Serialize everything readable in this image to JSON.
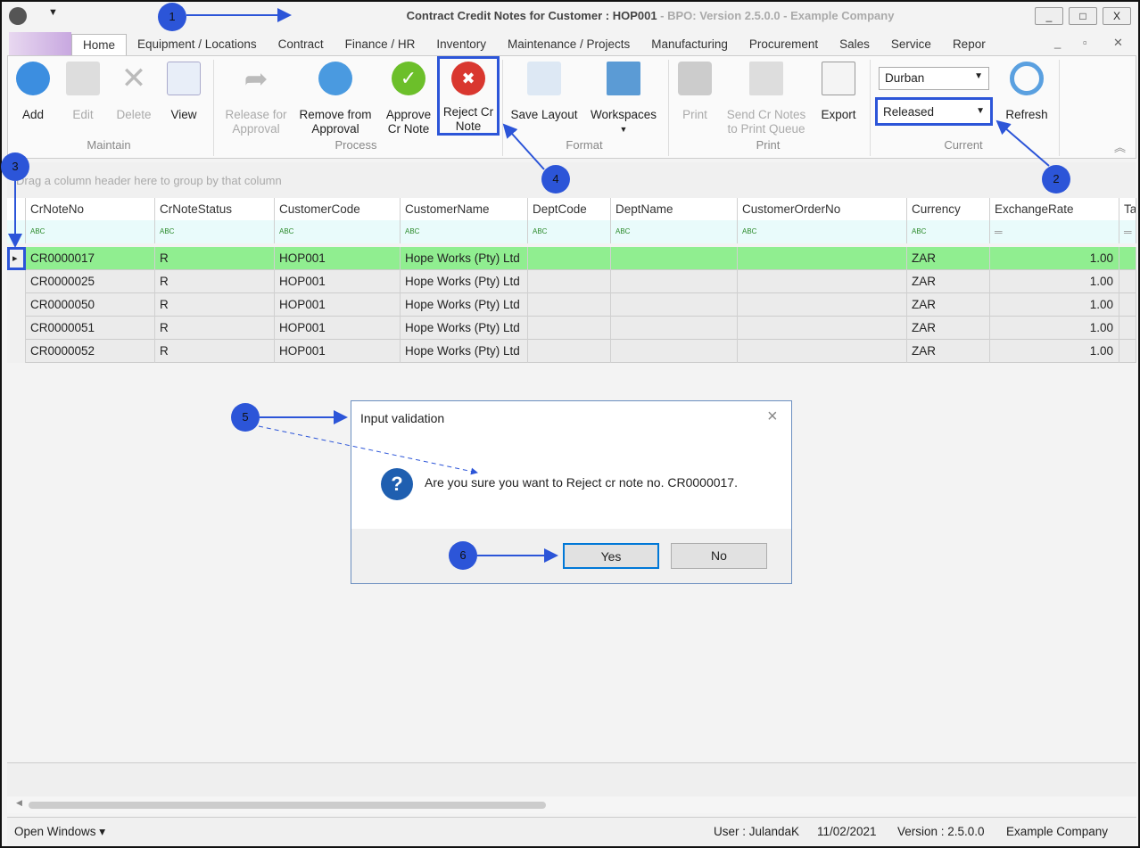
{
  "window": {
    "title_main": "Contract Credit Notes for Customer : HOP001",
    "title_sub": " - BPO: Version 2.5.0.0 - Example Company",
    "min": "_",
    "max": "□",
    "close": "X"
  },
  "tabs": [
    "Home",
    "Equipment / Locations",
    "Contract",
    "Finance / HR",
    "Inventory",
    "Maintenance / Projects",
    "Manufacturing",
    "Procurement",
    "Sales",
    "Service",
    "Repor"
  ],
  "ribbon": {
    "maintain": {
      "label": "Maintain",
      "add": "Add",
      "edit": "Edit",
      "delete": "Delete",
      "view": "View"
    },
    "process": {
      "label": "Process",
      "release": "Release for Approval",
      "remove": "Remove from Approval",
      "approve": "Approve Cr Note",
      "reject": "Reject Cr Note"
    },
    "format": {
      "label": "Format",
      "save_layout": "Save Layout",
      "workspaces": "Workspaces"
    },
    "print": {
      "label": "Print",
      "print": "Print",
      "send": "Send Cr Notes to Print Queue",
      "export": "Export"
    },
    "current": {
      "label": "Current",
      "site": "Durban",
      "status": "Released",
      "refresh": "Refresh"
    }
  },
  "grid": {
    "group_hint": "Drag a column header here to group by that column",
    "columns": [
      "CrNoteNo",
      "CrNoteStatus",
      "CustomerCode",
      "CustomerName",
      "DeptCode",
      "DeptName",
      "CustomerOrderNo",
      "Currency",
      "ExchangeRate",
      "Ta"
    ],
    "rows": [
      [
        "CR0000017",
        "R",
        "HOP001",
        "Hope Works (Pty) Ltd",
        "",
        "",
        "",
        "ZAR",
        "1.00"
      ],
      [
        "CR0000025",
        "R",
        "HOP001",
        "Hope Works (Pty) Ltd",
        "",
        "",
        "",
        "ZAR",
        "1.00"
      ],
      [
        "CR0000050",
        "R",
        "HOP001",
        "Hope Works (Pty) Ltd",
        "",
        "",
        "",
        "ZAR",
        "1.00"
      ],
      [
        "CR0000051",
        "R",
        "HOP001",
        "Hope Works (Pty) Ltd",
        "",
        "",
        "",
        "ZAR",
        "1.00"
      ],
      [
        "CR0000052",
        "R",
        "HOP001",
        "Hope Works (Pty) Ltd",
        "",
        "",
        "",
        "ZAR",
        "1.00"
      ]
    ]
  },
  "dialog": {
    "title": "Input validation",
    "message": "Are you sure you want to Reject cr note no. CR0000017.",
    "yes": "Yes",
    "no": "No",
    "close": "×"
  },
  "status": {
    "open_windows": "Open Windows ▾",
    "user": "User : JulandaK",
    "date": "11/02/2021",
    "version": "Version : 2.5.0.0",
    "company": "Example Company"
  },
  "annotations": [
    "1",
    "2",
    "3",
    "4",
    "5",
    "6"
  ],
  "colors": {
    "accent": "#2c55d8",
    "selected_row": "#90ee90",
    "reject": "#d9372f"
  }
}
